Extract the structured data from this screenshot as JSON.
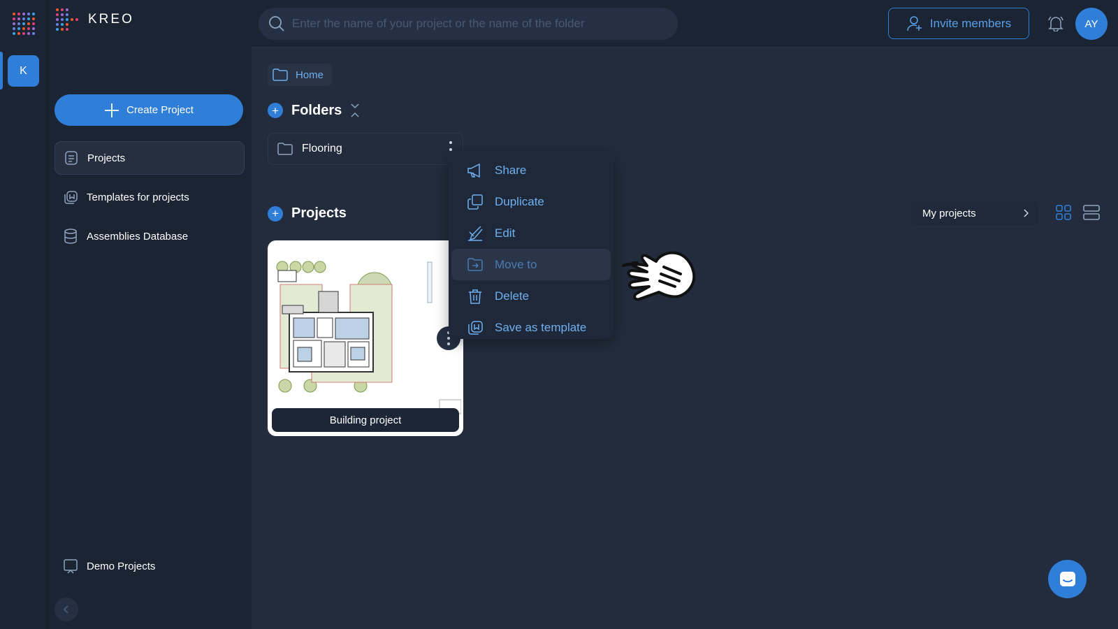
{
  "app": {
    "brand": "KREO",
    "workspace_initial": "K"
  },
  "search": {
    "placeholder": "Enter the name of your project or the name of the folder",
    "value": ""
  },
  "header": {
    "invite_label": "Invite members",
    "avatar_initials": "AY"
  },
  "sidebar": {
    "create_label": "Create Project",
    "items": [
      {
        "label": "Projects",
        "icon": "projects-icon",
        "active": true
      },
      {
        "label": "Templates for projects",
        "icon": "templates-icon",
        "active": false
      },
      {
        "label": "Assemblies Database",
        "icon": "database-icon",
        "active": false
      }
    ],
    "demo_label": "Demo Projects"
  },
  "breadcrumb": {
    "label": "Home"
  },
  "folders": {
    "title": "Folders",
    "items": [
      {
        "name": "Flooring"
      }
    ]
  },
  "projects": {
    "title": "Projects",
    "filter_label": "My projects",
    "items": [
      {
        "name": "Building project"
      }
    ]
  },
  "context_menu": {
    "items": [
      {
        "label": "Share",
        "icon": "megaphone-icon"
      },
      {
        "label": "Duplicate",
        "icon": "duplicate-icon"
      },
      {
        "label": "Edit",
        "icon": "edit-icon"
      },
      {
        "label": "Move to",
        "icon": "move-folder-icon",
        "hovered": true
      },
      {
        "label": "Delete",
        "icon": "trash-icon"
      },
      {
        "label": "Save as template",
        "icon": "template-icon"
      }
    ]
  },
  "colors": {
    "accent": "#2f7ed8",
    "background": "#1b2433",
    "main": "#222c3c",
    "menu_text": "#6fb0f0"
  }
}
